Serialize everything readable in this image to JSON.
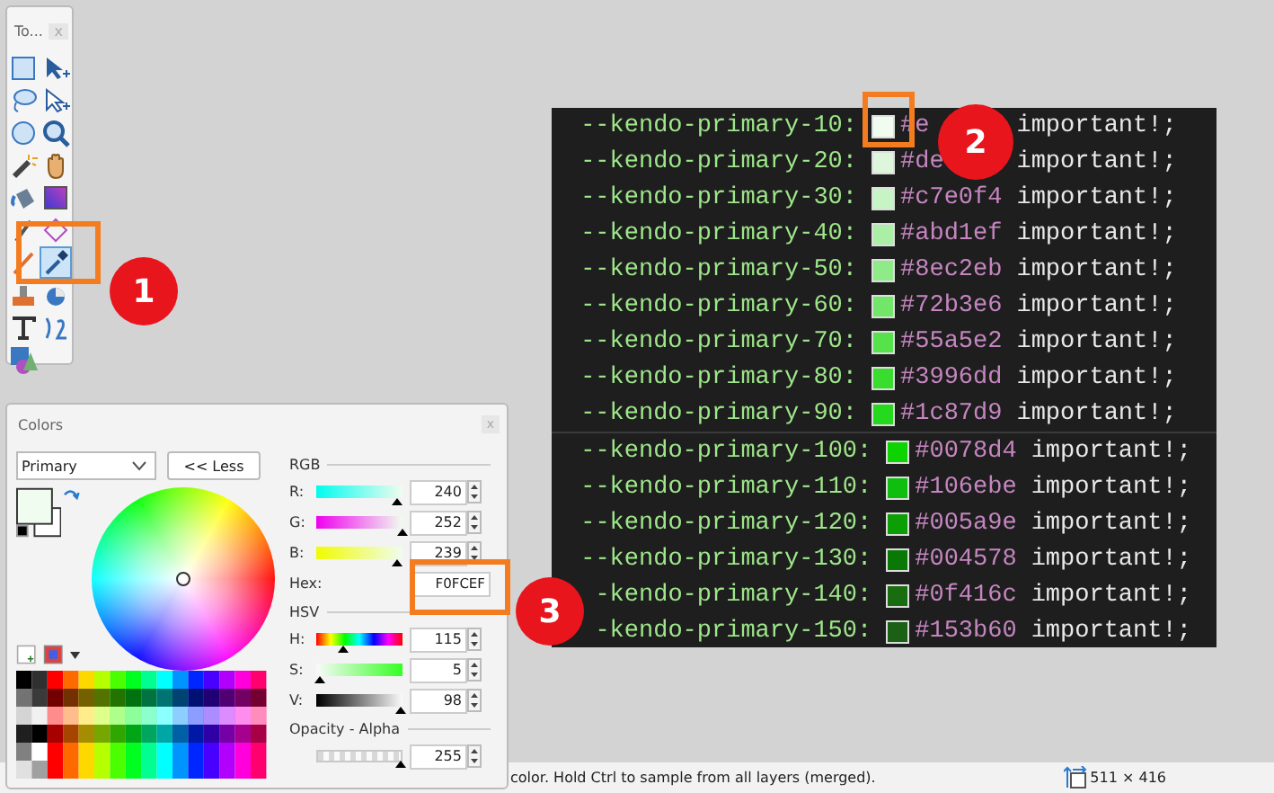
{
  "tools_window": {
    "title": "To...",
    "close": "x",
    "tools": [
      {
        "kind": "rect-select",
        "selected": false
      },
      {
        "kind": "move",
        "selected": false
      },
      {
        "kind": "lasso",
        "selected": false
      },
      {
        "kind": "move-outline",
        "selected": false
      },
      {
        "kind": "ellipse-select",
        "selected": false
      },
      {
        "kind": "zoom",
        "selected": false
      },
      {
        "kind": "wand",
        "selected": false
      },
      {
        "kind": "hand",
        "selected": false
      },
      {
        "kind": "bucket",
        "selected": false
      },
      {
        "kind": "gradient",
        "selected": false
      },
      {
        "kind": "brush",
        "selected": false
      },
      {
        "kind": "eraser",
        "selected": false
      },
      {
        "kind": "pencil",
        "selected": false
      },
      {
        "kind": "picker",
        "selected": true
      },
      {
        "kind": "stamp",
        "selected": false
      },
      {
        "kind": "recolor",
        "selected": false
      },
      {
        "kind": "text",
        "selected": false
      },
      {
        "kind": "line",
        "selected": false
      },
      {
        "kind": "shapes",
        "selected": false
      }
    ]
  },
  "colors_window": {
    "title": "Colors",
    "close": "x",
    "mode": "Primary",
    "less_button": "<< Less",
    "rgb_heading": "RGB",
    "hsv_heading": "HSV",
    "hex_label": "Hex:",
    "hex_value": "F0FCEF",
    "alpha_heading": "Opacity - Alpha",
    "rgb": [
      {
        "label": "R:",
        "value": "240",
        "level": 0.94
      },
      {
        "label": "G:",
        "value": "252",
        "level": 0.99
      },
      {
        "label": "B:",
        "value": "239",
        "level": 0.94
      }
    ],
    "hsv": [
      {
        "label": "H:",
        "value": "115",
        "level": 0.32
      },
      {
        "label": "S:",
        "value": "5",
        "level": 0.05
      },
      {
        "label": "V:",
        "value": "98",
        "level": 0.98
      }
    ],
    "alpha": {
      "value": "255",
      "level": 1.0
    }
  },
  "code_panel": {
    "blocks": [
      {
        "rows": [
          {
            "name": "--kendo-primary-10:",
            "color": "#f0fcef",
            "hex": "#e",
            "suffix": "important!;"
          },
          {
            "name": "--kendo-primary-20:",
            "color": "#def7dc",
            "hex": "#de",
            "suffix": "important!;"
          },
          {
            "name": "--kendo-primary-30:",
            "color": "#c7f4c4",
            "hex": "#c7e0f4",
            "suffix": "important!;"
          },
          {
            "name": "--kendo-primary-40:",
            "color": "#abefa6",
            "hex": "#abd1ef",
            "suffix": "important!;"
          },
          {
            "name": "--kendo-primary-50:",
            "color": "#8eeb87",
            "hex": "#8ec2eb",
            "suffix": "important!;"
          },
          {
            "name": "--kendo-primary-60:",
            "color": "#72e669",
            "hex": "#72b3e6",
            "suffix": "important!;"
          },
          {
            "name": "--kendo-primary-70:",
            "color": "#55e24b",
            "hex": "#55a5e2",
            "suffix": "important!;"
          },
          {
            "name": "--kendo-primary-80:",
            "color": "#39dd2d",
            "hex": "#3996dd",
            "suffix": "important!;"
          },
          {
            "name": "--kendo-primary-90:",
            "color": "#25d91c",
            "hex": "#1c87d9",
            "suffix": "important!;"
          }
        ]
      },
      {
        "rows": [
          {
            "name": "--kendo-primary-100:",
            "color": "#0dd400",
            "hex": "#0078d4",
            "suffix": "important!;"
          },
          {
            "name": "--kendo-primary-110:",
            "color": "#10be10",
            "hex": "#106ebe",
            "suffix": "important!;"
          },
          {
            "name": "--kendo-primary-120:",
            "color": "#0c9e05",
            "hex": "#005a9e",
            "suffix": "important!;"
          },
          {
            "name": "--kendo-primary-130:",
            "color": "#0a7804",
            "hex": "#004578",
            "suffix": "important!;"
          },
          {
            "name": "-kendo-primary-140:",
            "color": "#196c0f",
            "hex": "#0f416c",
            "suffix": "important!;"
          },
          {
            "name": "-kendo-primary-150:",
            "color": "#1b6015",
            "hex": "#153b60",
            "suffix": "important!;"
          }
        ]
      }
    ]
  },
  "callouts": [
    "1",
    "2",
    "3"
  ],
  "status_bar": {
    "hint": "color. Hold Ctrl to sample from all layers (merged).",
    "size": "511 × 416"
  }
}
